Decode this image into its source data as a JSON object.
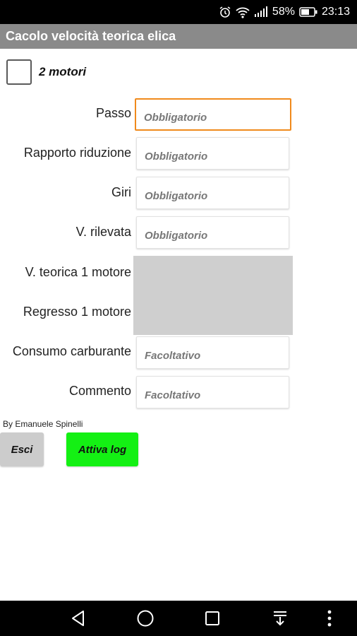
{
  "status_bar": {
    "battery_percent": "58%",
    "time": "23:13",
    "icons": [
      "alarm-icon",
      "wifi-icon",
      "signal-icon",
      "battery-icon"
    ]
  },
  "app": {
    "title": "Cacolo velocità teorica elica"
  },
  "checkbox": {
    "label": "2 motori",
    "checked": false
  },
  "form": {
    "passo": {
      "label": "Passo",
      "placeholder": "Obbligatorio"
    },
    "rapporto": {
      "label": "Rapporto riduzione",
      "placeholder": "Obbligatorio"
    },
    "giri": {
      "label": "Giri",
      "placeholder": "Obbligatorio"
    },
    "rilevata": {
      "label": "V. rilevata",
      "placeholder": "Obbligatorio"
    },
    "teorica": {
      "label": "V. teorica 1 motore"
    },
    "regresso": {
      "label": "Regresso 1 motore"
    },
    "consumo": {
      "label": "Consumo carburante",
      "placeholder": "Facoltativo"
    },
    "commento": {
      "label": "Commento",
      "placeholder": "Facoltativo"
    }
  },
  "author": "By Emanuele Spinelli",
  "buttons": {
    "esci": "Esci",
    "log": "Attiva log"
  },
  "colors": {
    "focus_border": "#f08a1c",
    "log_button": "#14f014",
    "title_bar": "#8a8a8a"
  },
  "nav_bar": {
    "icons": [
      "back-icon",
      "home-icon",
      "recents-icon",
      "notification-pull-icon",
      "more-icon"
    ]
  }
}
